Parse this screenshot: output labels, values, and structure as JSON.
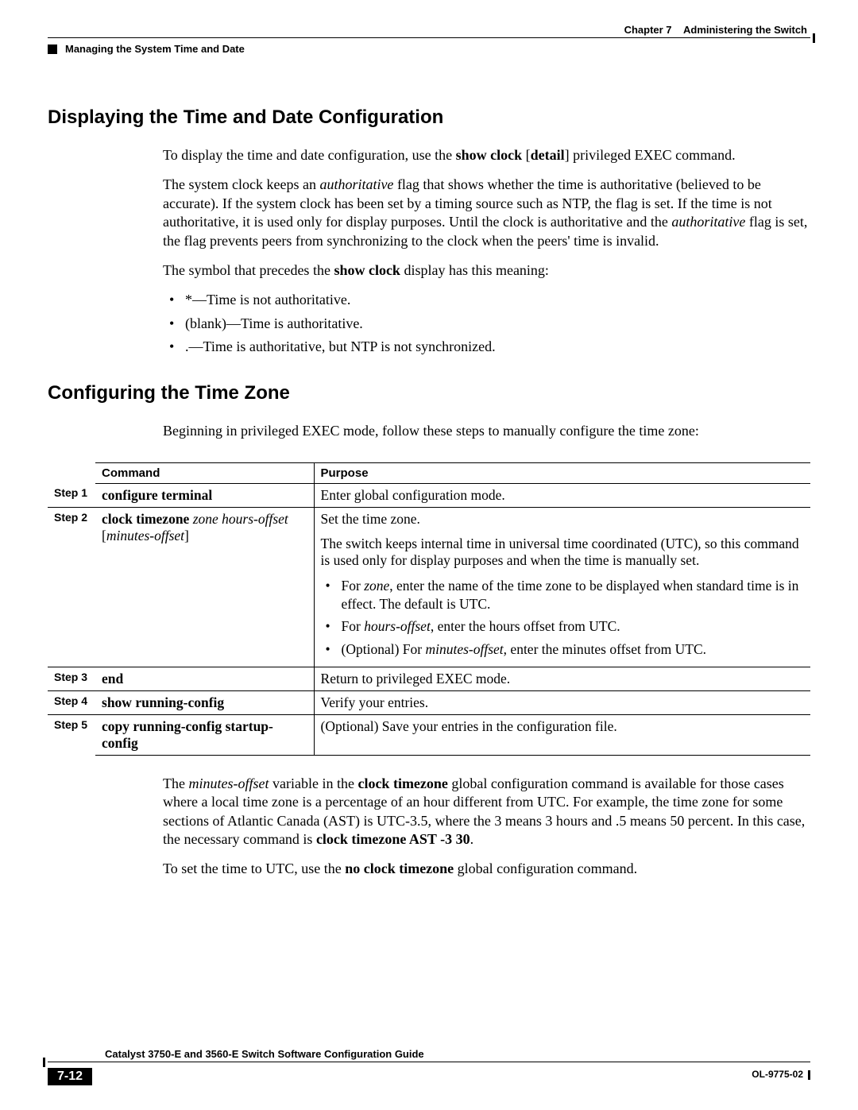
{
  "header": {
    "chapter": "Chapter 7",
    "chapter_title": "Administering the Switch",
    "section": "Managing the System Time and Date"
  },
  "s1": {
    "heading": "Displaying the Time and Date Configuration",
    "p1_a": "To display the time and date configuration, use the ",
    "p1_cmd": "show clock",
    "p1_b": " [",
    "p1_detail": "detail",
    "p1_c": "] privileged EXEC command.",
    "p2_a": "The system clock keeps an ",
    "p2_i1": "authoritative",
    "p2_b": " flag that shows whether the time is authoritative (believed to be accurate). If the system clock has been set by a timing source such as NTP, the flag is set. If the time is not authoritative, it is used only for display purposes. Until the clock is authoritative and the ",
    "p2_i2": "authoritative",
    "p2_c": " flag is set, the flag prevents peers from synchronizing to the clock when the peers' time is invalid.",
    "p3_a": "The symbol that precedes the ",
    "p3_cmd": "show clock",
    "p3_b": " display has this meaning:",
    "b1": "*—Time is not authoritative.",
    "b2": "(blank)—Time is authoritative.",
    "b3": ".—Time is authoritative, but NTP is not synchronized."
  },
  "s2": {
    "heading": "Configuring the Time Zone",
    "intro": "Beginning in privileged EXEC mode, follow these steps to manually configure the time zone:",
    "th_cmd": "Command",
    "th_purpose": "Purpose",
    "step1": "Step 1",
    "r1_cmd": "configure terminal",
    "r1_purpose": "Enter global configuration mode.",
    "step2": "Step 2",
    "r2_cmd_b": "clock timezone",
    "r2_cmd_i1": " zone hours-offset",
    "r2_cmd_br": "[",
    "r2_cmd_i2": "minutes-offset",
    "r2_cmd_br2": "]",
    "r2_p1": "Set the time zone.",
    "r2_p2": "The switch keeps internal time in universal time coordinated (UTC), so this command is used only for display purposes and when the time is manually set.",
    "r2_b1_a": "For ",
    "r2_b1_i": "zone",
    "r2_b1_b": ", enter the name of the time zone to be displayed when standard time is in effect. The default is UTC.",
    "r2_b2_a": "For ",
    "r2_b2_i": "hours-offset",
    "r2_b2_b": ", enter the hours offset from UTC.",
    "r2_b3_a": "(Optional) For ",
    "r2_b3_i": "minutes-offset",
    "r2_b3_b": ", enter the minutes offset from UTC.",
    "step3": "Step 3",
    "r3_cmd": "end",
    "r3_purpose": "Return to privileged EXEC mode.",
    "step4": "Step 4",
    "r4_cmd": "show running-config",
    "r4_purpose": "Verify your entries.",
    "step5": "Step 5",
    "r5_cmd": "copy running-config startup-config",
    "r5_purpose": "(Optional) Save your entries in the configuration file.",
    "p_after1_a": "The ",
    "p_after1_i1": "minutes-offset",
    "p_after1_b": " variable in the ",
    "p_after1_bold1": "clock timezone",
    "p_after1_c": " global configuration command is available for those cases where a local time zone is a percentage of an hour different from UTC. For example, the time zone for some sections of Atlantic Canada (AST) is UTC-3.5, where the 3 means 3 hours and .5 means 50 percent. In this case, the necessary command is ",
    "p_after1_bold2": "clock timezone AST -3 30",
    "p_after1_d": ".",
    "p_after2_a": "To set the time to UTC, use the ",
    "p_after2_bold": "no clock timezone",
    "p_after2_b": " global configuration command."
  },
  "footer": {
    "guide": "Catalyst 3750-E and 3560-E Switch Software Configuration Guide",
    "page": "7-12",
    "docid": "OL-9775-02"
  }
}
